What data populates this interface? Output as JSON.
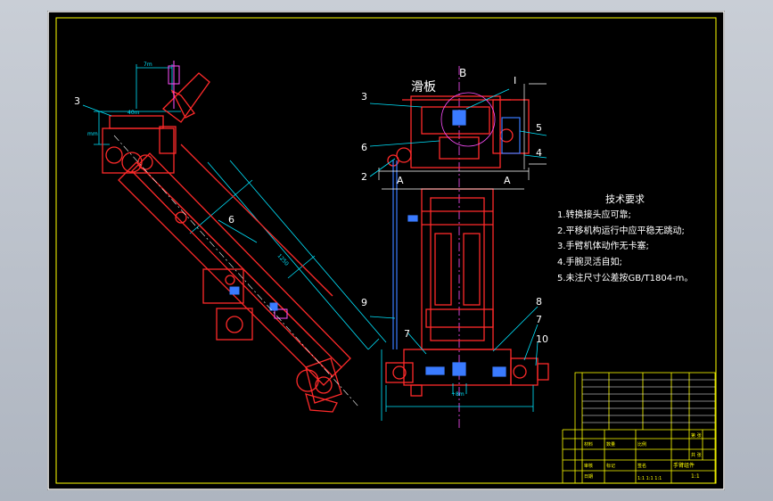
{
  "drawing": {
    "section_label": "B",
    "view_label": "I",
    "section_a_left": "A",
    "section_a_right": "A",
    "slide_plate_label": "滑板",
    "left_view_callouts": [
      "3",
      "6"
    ],
    "right_view_callouts": [
      "3",
      "6",
      "2",
      "9",
      "7",
      "5",
      "4",
      "8",
      "7",
      "10"
    ],
    "dimension_texts": [
      "7m",
      "40m",
      "mm",
      "+50",
      "1250",
      "+8m",
      "m",
      "m",
      "m",
      "8m",
      "A",
      "r",
      "r"
    ]
  },
  "requirements": {
    "title": "技术要求",
    "items": [
      "1.转换接头应可靠;",
      "2.平移机构运行中应平稳无跳动;",
      "3.手臂机体动作无卡塞;",
      "4.手腕灵活自如;",
      "5.未注尺寸公差按GB/T1804-m。"
    ]
  },
  "title_block": {
    "drawing_name": "手臂组件",
    "sheet_ratio": "1:1",
    "bottom_code": "1:1 1:1 1:1",
    "row_texts": [
      "材料",
      "数量",
      "比例",
      "审核",
      "标记",
      "签名",
      "日期",
      "第 张",
      "共 张"
    ]
  },
  "colors": {
    "background": "#000000",
    "outer_frame": "#ffffff",
    "inner_frame": "#ffff00",
    "part_outline": "#ff2a2a",
    "dimension": "#00e5ff",
    "text": "#ffffff",
    "center_line": "#ff4fff",
    "hidden": "#3a7bff",
    "title_block": "#ffff00"
  }
}
